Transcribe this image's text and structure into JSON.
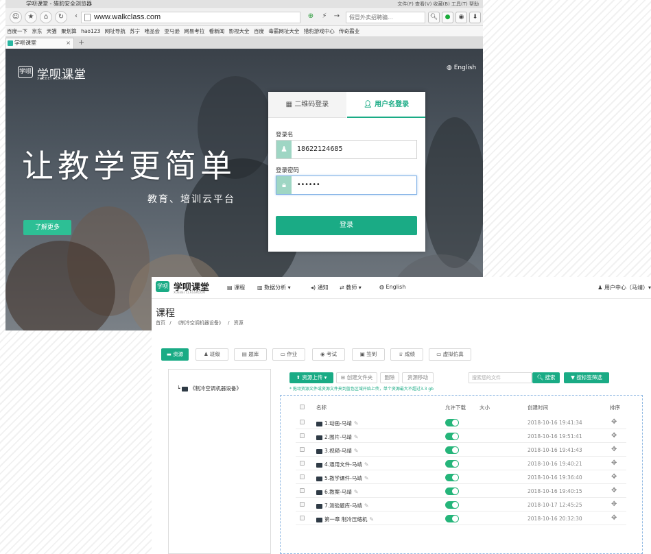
{
  "browser": {
    "title": "学呗课堂 - 猎豹安全浏览器",
    "menu": "文件(F)  查看(V)  收藏(B)  工具(T)  帮助",
    "url": "www.walkclass.com",
    "search_placeholder": "假冒外卖招聘骗...",
    "bookmarks": [
      "百度一下",
      "京东",
      "天猫",
      "聚划算",
      "hao123",
      "网址导航",
      "苏宁",
      "唯品会",
      "亚马逊",
      "网易考拉",
      "看新闻",
      "影视大全",
      "百度",
      "毒霸网址大全",
      "猎豹游戏中心",
      "传奇霸业"
    ],
    "tab_label": "学呗课堂",
    "new_tab": "+"
  },
  "hero": {
    "logo_mark": "学呗",
    "logo_name": "学呗课堂",
    "logo_sub": "XUEBEI CLASSROOM",
    "language": "English",
    "slogan": "让教学更简单",
    "subslogan": "教育、培训云平台",
    "learn_more": "了解更多"
  },
  "login": {
    "tab_qr": "二维码登录",
    "tab_user": "用户名登录",
    "username_label": "登录名",
    "username_value": "18622124685",
    "password_label": "登录密码",
    "password_value": "••••••",
    "submit": "登录"
  },
  "course": {
    "logo_mark": "学呗",
    "logo_name": "学呗课堂",
    "logo_sub": "XUEBEI CLASSROOM",
    "nav": [
      "课程",
      "数据分析 ▾",
      "通知",
      "教师 ▾",
      "English"
    ],
    "user_center": "用户中心（马靖）▾",
    "page_title": "课程",
    "breadcrumb": [
      "首页",
      "/",
      "《制冷空调机器设备》",
      "/",
      "资源"
    ],
    "tabs": [
      "资源",
      "班级",
      "题库",
      "作业",
      "考试",
      "签到",
      "成绩",
      "虚拟仿真"
    ],
    "tree_root": "《制冷空调机器设备》",
    "toolbar": {
      "upload": "资源上传 ▾",
      "new_folder": "创建文件夹",
      "delete": "删除",
      "move": "资源移动",
      "search_placeholder": "搜索您的文件",
      "search": "搜索",
      "filter": "按标签筛选"
    },
    "hint": "* 拖动资源文件或资源文件夹到蓝色区域开始上传，单个资源最大不超过3.3 gb",
    "columns": {
      "name": "名称",
      "download": "允许下载",
      "size": "大小",
      "created": "创建时间",
      "sort": "排序"
    },
    "files": [
      {
        "name": "1.动画-马靖",
        "time": "2018-10-16 19:41:34"
      },
      {
        "name": "2.图片-马靖",
        "time": "2018-10-16 19:51:41"
      },
      {
        "name": "3.视频-马靖",
        "time": "2018-10-16 19:41:43"
      },
      {
        "name": "4.通用文件-马靖",
        "time": "2018-10-16 19:40:21"
      },
      {
        "name": "5.教学课件-马靖",
        "time": "2018-10-16 19:36:40"
      },
      {
        "name": "6.教案-马靖",
        "time": "2018-10-16 19:40:15"
      },
      {
        "name": "7.测验题库-马靖",
        "time": "2018-10-17 12:45:25"
      },
      {
        "name": "第一章 制冷压缩机",
        "time": "2018-10-16 20:32:30"
      }
    ]
  },
  "colors": {
    "accent": "#1aab85",
    "toggle_on": "#25b57a",
    "dropzone_border": "#8fb8e2"
  }
}
